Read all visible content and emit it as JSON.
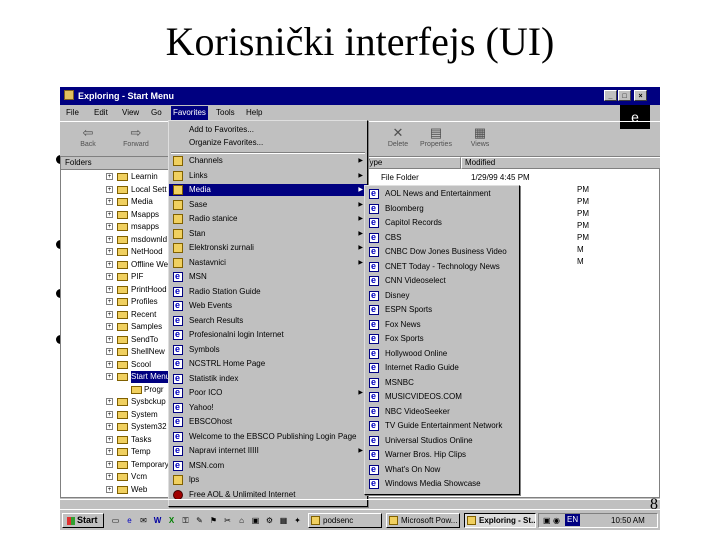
{
  "slide": {
    "title": "Korisnički interfejs (UI)",
    "number": "8"
  },
  "window": {
    "title": "Exploring - Start Menu",
    "controls": [
      "_",
      "□",
      "×"
    ],
    "menu": [
      "File",
      "Edit",
      "View",
      "Go",
      "Favorites",
      "Tools",
      "Help"
    ],
    "toolbar": {
      "back": "Back",
      "forward": "Forward",
      "delete": "Delete",
      "properties": "Properties",
      "views": "Views"
    }
  },
  "folders": {
    "header": "Folders",
    "items": [
      "Learnin",
      "Local Sett",
      "Media",
      "Msapps",
      "msapps",
      "msdownld",
      "NetHood",
      "Offline We",
      "PIF",
      "PrintHood",
      "Profiles",
      "Recent",
      "Samples",
      "SendTo",
      "ShellNew",
      "Scool",
      "Start Menu",
      "Progr",
      "Sysbckup",
      "System",
      "System32",
      "Tasks",
      "Temp",
      "Temporary",
      "Vcm",
      "Web"
    ],
    "selected": "Start Menu"
  },
  "file_list": {
    "columns": [
      "Type",
      "Modified"
    ],
    "row1": {
      "type": "File Folder",
      "modified": "1/29/99 4:45 PM"
    },
    "fragments": [
      "PM",
      "PM",
      "PM",
      "PM",
      "PM",
      "M",
      "M"
    ]
  },
  "favorites_menu": {
    "top": [
      "Add to Favorites...",
      "Organize Favorites..."
    ],
    "items": [
      "Channels",
      "Links",
      "Media",
      "Sase",
      "Radio stanice",
      "Stan",
      "Elektronski zurnali",
      "Nastavnici",
      "MSN",
      "Radio Station Guide",
      "Web Events",
      "Search Results",
      "Profesionalni login Internet",
      "Symbols",
      "NCSTRL Home Page",
      "Statistik index",
      "Poor ICO",
      "Yahoo!",
      "EBSCOhost",
      "Welcome to the EBSCO Publishing Login Page",
      "Napravi internet IIIII",
      "MSN.com",
      "lps",
      "Free AOL & Unlimited Internet"
    ],
    "highlighted": "Media"
  },
  "media_menu": {
    "items": [
      "AOL News and Entertainment",
      "Bloomberg",
      "Capitol Records",
      "CBS",
      "CNBC Dow Jones Business Video",
      "CNET Today - Technology News",
      "CNN Videoselect",
      "Disney",
      "ESPN Sports",
      "Fox News",
      "Fox Sports",
      "Hollywood Online",
      "Internet Radio Guide",
      "MSNBC",
      "MUSICVIDEOS.COM",
      "NBC VideoSeeker",
      "TV Guide Entertainment Network",
      "Universal Studios Online",
      "Warner Bros. Hip Clips",
      "What's On Now",
      "Windows Media Showcase"
    ]
  },
  "taskbar": {
    "start": "Start",
    "tasks": [
      "podsenc",
      "Microsoft Pow...",
      "Exploring - St..."
    ],
    "clock": "10:50 AM",
    "tray_tag": "EN"
  }
}
